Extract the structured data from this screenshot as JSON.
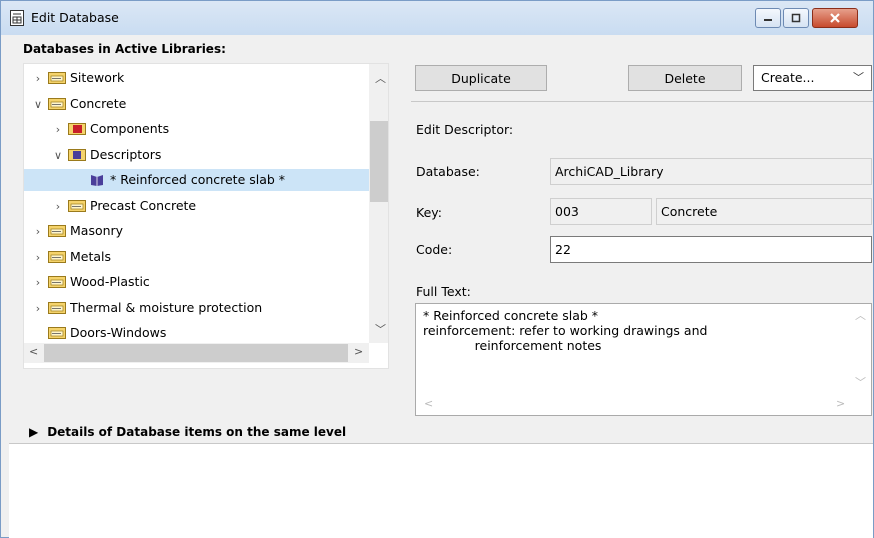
{
  "window": {
    "title": "Edit Database"
  },
  "left": {
    "header": "Databases in Active Libraries:",
    "tree": [
      {
        "label": "Sitework",
        "indent": 0,
        "chevron": ">",
        "icon": "folder-icon"
      },
      {
        "label": "Concrete",
        "indent": 0,
        "chevron": "v",
        "icon": "folder-icon"
      },
      {
        "label": "Components",
        "indent": 1,
        "chevron": ">",
        "icon": "components-icon"
      },
      {
        "label": "Descriptors",
        "indent": 1,
        "chevron": "v",
        "icon": "descriptors-icon"
      },
      {
        "label": "* Reinforced concrete slab *",
        "indent": 2,
        "chevron": "",
        "icon": "book-icon",
        "selected": true
      },
      {
        "label": "Precast Concrete",
        "indent": 1,
        "chevron": ">",
        "icon": "folder-icon"
      },
      {
        "label": "Masonry",
        "indent": 0,
        "chevron": ">",
        "icon": "folder-icon"
      },
      {
        "label": "Metals",
        "indent": 0,
        "chevron": ">",
        "icon": "folder-icon"
      },
      {
        "label": "Wood-Plastic",
        "indent": 0,
        "chevron": ">",
        "icon": "folder-icon"
      },
      {
        "label": "Thermal & moisture protection",
        "indent": 0,
        "chevron": ">",
        "icon": "folder-icon"
      },
      {
        "label": "Doors-Windows",
        "indent": 0,
        "chevron": "",
        "icon": "folder-icon"
      }
    ]
  },
  "toolbar": {
    "duplicate_label": "Duplicate",
    "delete_label": "Delete",
    "create_value": "Create..."
  },
  "descriptor": {
    "section_label": "Edit Descriptor:",
    "database_label": "Database:",
    "database_value": "ArchiCAD_Library",
    "key_label": "Key:",
    "key_value": "003",
    "key_name": "Concrete",
    "code_label": "Code:",
    "code_value": "22",
    "fulltext_label": "Full Text:",
    "fulltext_value": "* Reinforced concrete slab *\nreinforcement: refer to working drawings and\n             reinforcement notes"
  },
  "details": {
    "label": "Details of Database items on the same level"
  },
  "colors": {
    "selected": "#cce4f7",
    "accent": "#7a9cc6"
  }
}
